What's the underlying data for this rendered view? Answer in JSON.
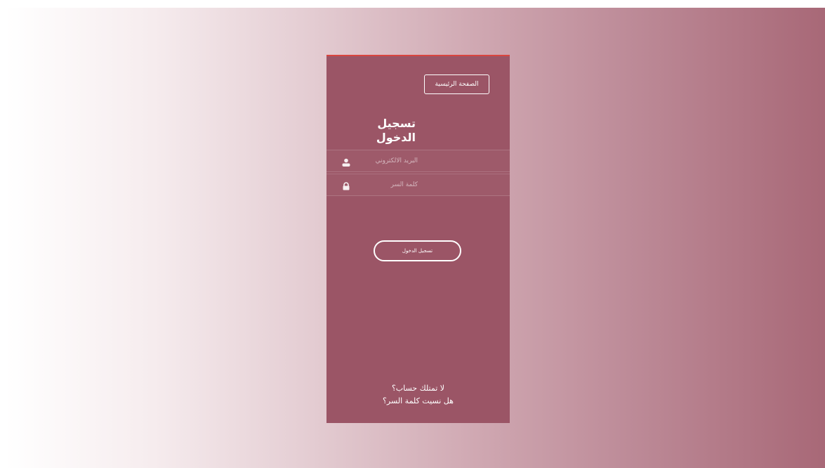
{
  "header": {
    "home_label": "الصفحة الرئيسية"
  },
  "form": {
    "title": "تسجيل الدخول",
    "email": {
      "value": "",
      "placeholder": "البريد الالكتروني",
      "icon": "user-icon"
    },
    "password": {
      "value": "",
      "placeholder": "كلمة السر",
      "icon": "lock-icon"
    },
    "submit_label": "تسجيل الدخول"
  },
  "links": {
    "no_account": "لا تمتلك حساب؟",
    "forgot_password": "هل نسيت كلمة السر؟"
  },
  "colors": {
    "card": "#9b5566",
    "card_top_border": "#d9453f",
    "text": "#ffffff",
    "gradient_start": "#ffffff",
    "gradient_end": "#a86877"
  }
}
